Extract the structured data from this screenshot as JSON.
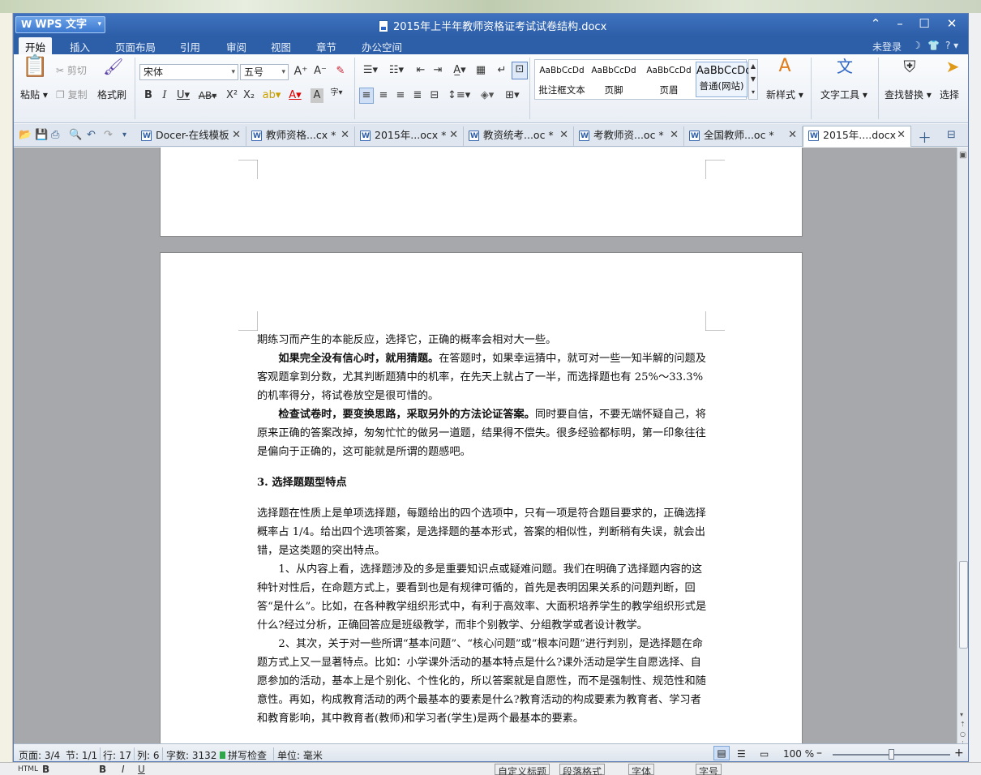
{
  "app": {
    "name": "WPS 文字",
    "title": "2015年上半年教师资格证考试试卷结构.docx"
  },
  "menu": {
    "items": [
      "开始",
      "插入",
      "页面布局",
      "引用",
      "审阅",
      "视图",
      "章节",
      "办公空间"
    ],
    "login": "未登录"
  },
  "ribbon": {
    "paste": "粘贴",
    "cut": "剪切",
    "copy": "复制",
    "format_painter": "格式刷",
    "font_name": "宋体",
    "font_size": "五号",
    "styles": [
      {
        "sample": "AaBbCcDd",
        "name": "批注框文本"
      },
      {
        "sample": "AaBbCcDd",
        "name": "页脚"
      },
      {
        "sample": "AaBbCcDd",
        "name": "页眉"
      },
      {
        "sample": "AaBbCcDc",
        "name": "普通(网站)"
      }
    ],
    "new_style": "新样式",
    "text_tools": "文字工具",
    "find_replace": "查找替换",
    "select": "选择"
  },
  "tabs": [
    {
      "label": "Docer-在线模板"
    },
    {
      "label": "教师资格...cx *"
    },
    {
      "label": "2015年...ocx *"
    },
    {
      "label": "教资统考...oc *"
    },
    {
      "label": "考教师资...oc *"
    },
    {
      "label": "全国教师...oc *"
    },
    {
      "label": "2015年....docx"
    }
  ],
  "document": {
    "p1": "期练习而产生的本能反应，选择它，正确的概率会相对大一些。",
    "p2_bold": "如果完全没有信心时，就用猜题。",
    "p2_rest": "在答题时，如果幸运猜中，就可对一些一知半解的问题及客观题拿到分数，尤其判断题猜中的机率，在先天上就占了一半，而选择题也有 25%～33.3%的机率得分，将试卷放空是很可惜的。",
    "p3_bold": "检查试卷时，要变换思路，采取另外的方法论证答案。",
    "p3_rest": "同时要自信，不要无端怀疑自己，将原来正确的答案改掉，匆匆忙忙的做另一道题，结果得不偿失。很多经验都标明，第一印象往往是偏向于正确的，这可能就是所谓的题感吧。",
    "heading": "3. 选择题题型特点",
    "p4": "选择题在性质上是单项选择题，每题给出的四个选项中，只有一项是符合题目要求的，正确选择概率占 1/4。给出四个选项答案，是选择题的基本形式，答案的相似性，判断稍有失误，就会出错，是这类题的突出特点。",
    "p5": "1、从内容上看，选择题涉及的多是重要知识点或疑难问题。我们在明确了选择题内容的这种针对性后，在命题方式上，要看到也是有规律可循的，首先是表明因果关系的问题判断，回答“是什么”。比如，在各种教学组织形式中，有利于高效率、大面积培养学生的教学组织形式是什么?经过分析，正确回答应是班级教学，而非个别教学、分组教学或者设计教学。",
    "p6": "2、其次，关于对一些所谓“基本问题”、“核心问题”或“根本问题”进行判别，是选择题在命题方式上又一显著特点。比如：小学课外活动的基本特点是什么?课外活动是学生自愿选择、自愿参加的活动，基本上是个别化、个性化的，所以答案就是自愿性，而不是强制性、规范性和随意性。再如，构成教育活动的两个最基本的要素是什么?教育活动的构成要素为教育者、学习者和教育影响，其中教育者(教师)和学习者(学生)是两个最基本的要素。"
  },
  "status": {
    "page": "页面: 3/4",
    "section": "节: 1/1",
    "row": "行: 17",
    "col": "列: 6",
    "words": "字数: 3132",
    "spell": "拼写检查",
    "unit": "单位: 毫米",
    "zoom": "100 %",
    "zoom_level": 0.5
  },
  "bottom": {
    "custom_heading": "自定义标题",
    "para_format": "段落格式",
    "font": "字体",
    "size": "字号"
  }
}
